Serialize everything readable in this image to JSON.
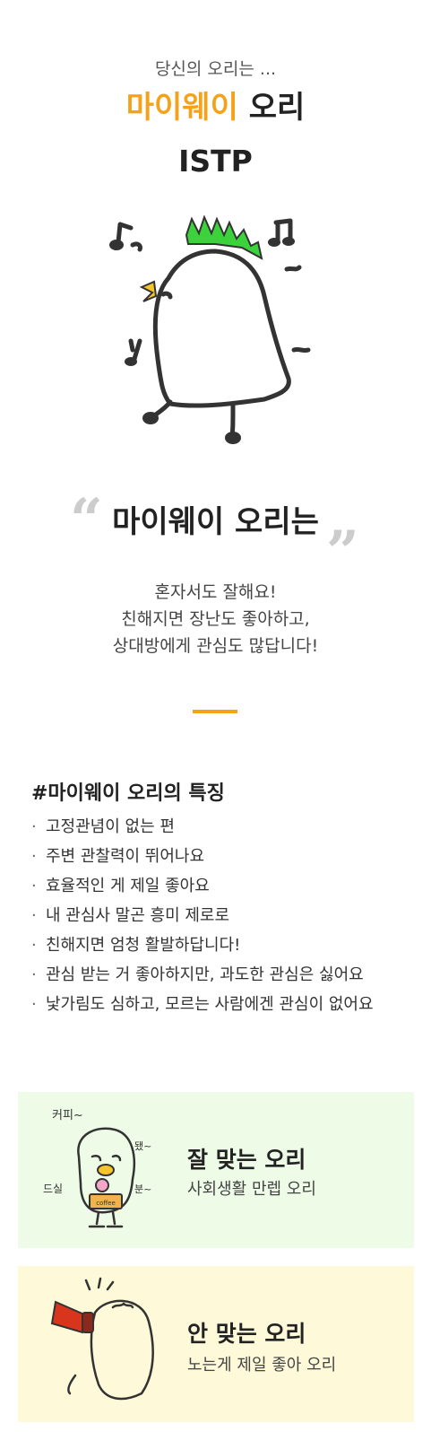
{
  "header": {
    "subtitle": "당신의 오리는 ...",
    "title_accent": "마이웨이",
    "title_rest": " 오리",
    "mbti": "ISTP"
  },
  "quote": {
    "open_mark": "“",
    "close_mark": "”",
    "title": "마이웨이 오리는",
    "lines": [
      "혼자서도 잘해요!",
      "친해지면 장난도 좋아하고,",
      "상대방에게 관심도 많답니다!"
    ]
  },
  "traits": {
    "title": "#마이웨이 오리의 특징",
    "bullet": "·",
    "items": [
      "고정관념이 없는 편",
      "주변 관찰력이 뛰어나요",
      "효율적인 게 제일 좋아요",
      "내 관심사 말곤 흥미 제로로",
      "친해지면 엄청 활발하답니다!",
      "관심 받는 거 좋아하지만, 과도한 관심은 싫어요",
      "낯가림도 심하고, 모르는 사람에겐 관심이 없어요"
    ]
  },
  "match_good": {
    "title": "잘 맞는 오리",
    "subtitle": "사회생활 만렙 오리",
    "doodles": [
      "커피~",
      "됐~",
      "드실",
      "분~"
    ],
    "box_label": "coffee"
  },
  "match_bad": {
    "title": "안 맞는 오리",
    "subtitle": "노는게 제일 좋아 오리"
  },
  "colors": {
    "accent": "#f5a21b",
    "hair": "#3bd23b",
    "good_bg": "#eefbe7",
    "bad_bg": "#fef9d8",
    "megaphone": "#d9341c"
  }
}
